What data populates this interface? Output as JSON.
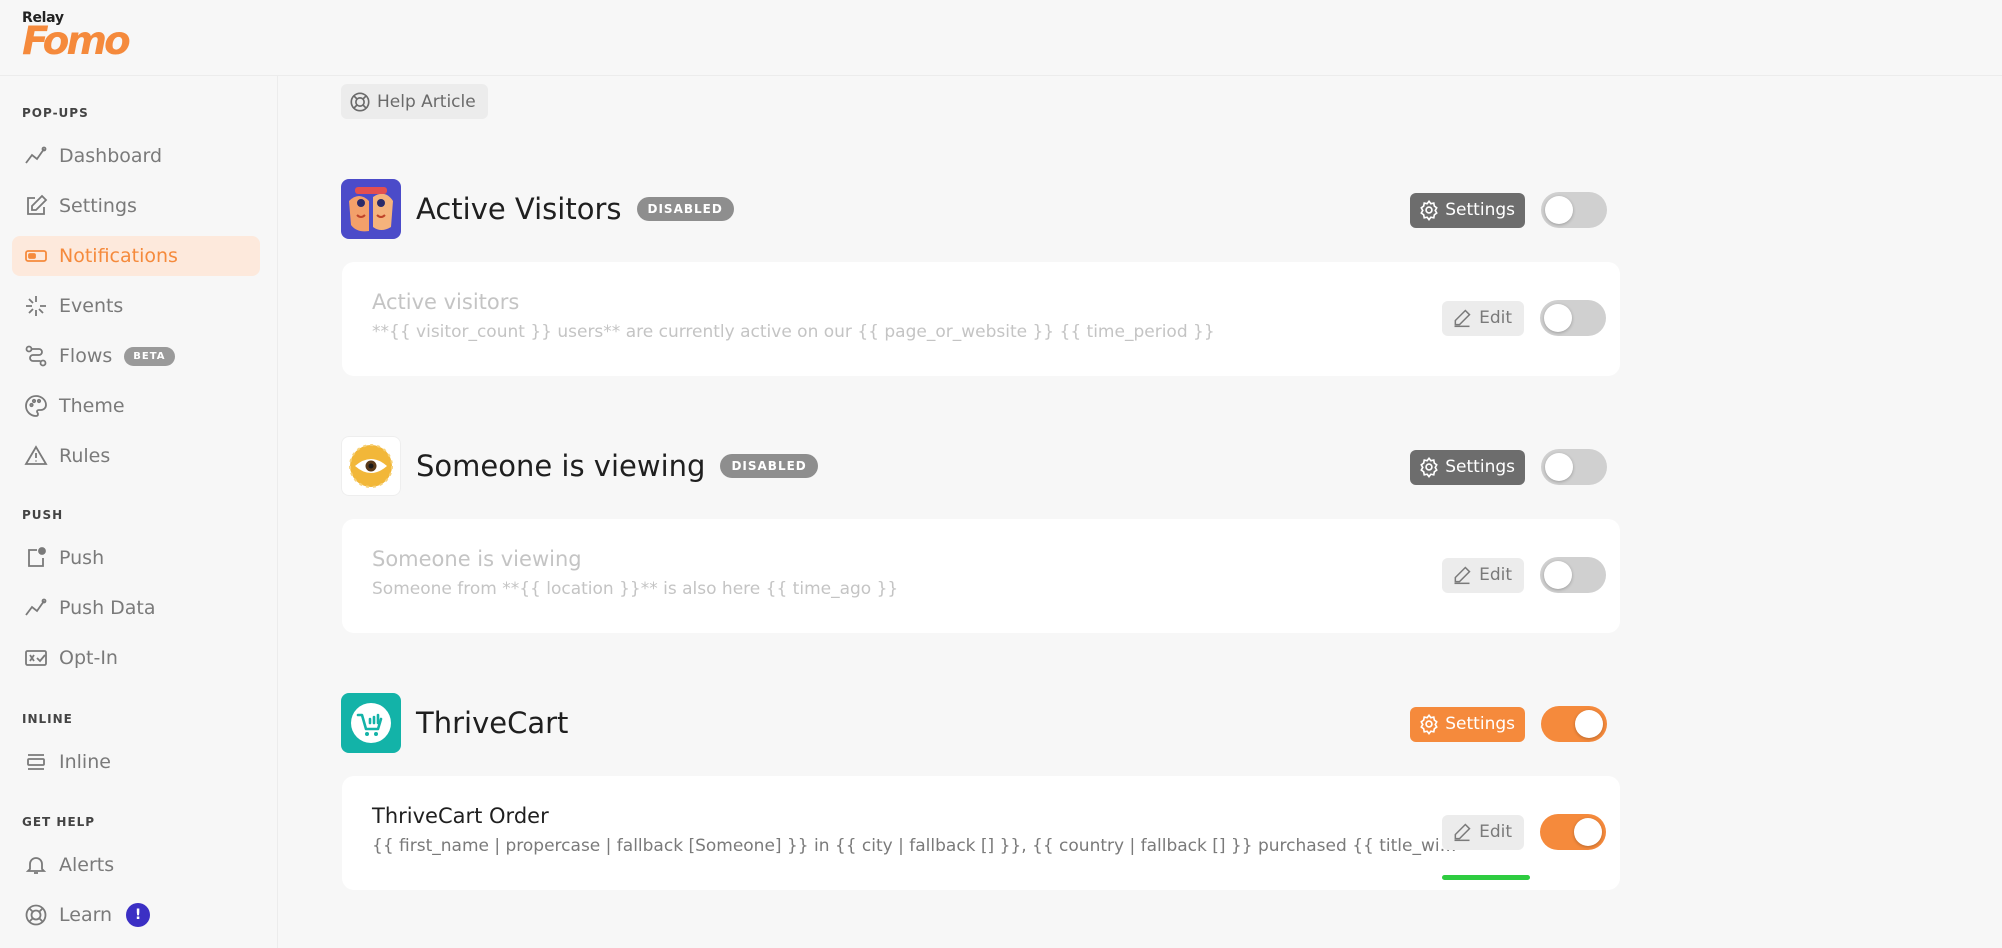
{
  "brand": {
    "top_label": "Relay",
    "logo_text": "Fomo"
  },
  "sidebar": {
    "sections": [
      {
        "label": "POP-UPS",
        "items": [
          {
            "label": "Dashboard",
            "icon": "trend-line-icon"
          },
          {
            "label": "Settings",
            "icon": "edit-square-icon"
          },
          {
            "label": "Notifications",
            "icon": "toggle-icon",
            "active": true
          },
          {
            "label": "Events",
            "icon": "sparkle-icon"
          },
          {
            "label": "Flows",
            "icon": "flow-icon",
            "badge": "BETA"
          },
          {
            "label": "Theme",
            "icon": "palette-icon"
          },
          {
            "label": "Rules",
            "icon": "warning-triangle-icon"
          }
        ]
      },
      {
        "label": "PUSH",
        "items": [
          {
            "label": "Push",
            "icon": "push-icon"
          },
          {
            "label": "Push Data",
            "icon": "trend-line-icon"
          },
          {
            "label": "Opt-In",
            "icon": "opt-in-icon"
          }
        ]
      },
      {
        "label": "INLINE",
        "items": [
          {
            "label": "Inline",
            "icon": "inline-icon"
          }
        ]
      },
      {
        "label": "GET HELP",
        "items": [
          {
            "label": "Alerts",
            "icon": "bell-icon"
          },
          {
            "label": "Learn",
            "icon": "lifebuoy-icon",
            "badge": "!"
          }
        ]
      }
    ]
  },
  "help_article": {
    "label": "Help Article",
    "icon": "lifebuoy-icon"
  },
  "groups": [
    {
      "title": "Active Visitors",
      "status_badge": "DISABLED",
      "settings_label": "Settings",
      "enabled": false,
      "icon": "active-visitors-app-icon",
      "card": {
        "title": "Active visitors",
        "description": "**{{ visitor_count }} users** are currently active on our {{ page_or_website }} {{ time_period }}",
        "edit_label": "Edit",
        "enabled": false
      }
    },
    {
      "title": "Someone is viewing",
      "status_badge": "DISABLED",
      "settings_label": "Settings",
      "enabled": false,
      "icon": "eye-app-icon",
      "card": {
        "title": "Someone is viewing",
        "description": "Someone from **{{ location }}** is also here {{ time_ago }}",
        "edit_label": "Edit",
        "enabled": false
      }
    },
    {
      "title": "ThriveCart",
      "status_badge": "",
      "settings_label": "Settings",
      "enabled": true,
      "icon": "thrivecart-app-icon",
      "card": {
        "title": "ThriveCart Order",
        "description": "{{ first_name | propercase | fallback [Someone] }} in {{ city | fallback [] }}, {{ country | fallback [] }} purchased {{ title_with_link }}",
        "edit_label": "Edit",
        "enabled": true
      }
    }
  ],
  "colors": {
    "accent": "#f58a3c",
    "accent_soft": "#fde9dc",
    "disabled_badge": "#8e8e8e",
    "highlight": "#2ecc40"
  }
}
